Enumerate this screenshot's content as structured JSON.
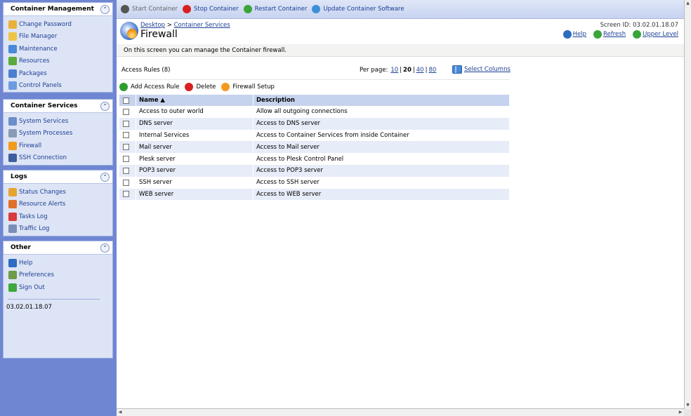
{
  "sidebar": {
    "panels": [
      {
        "title": "Container Management",
        "items": [
          {
            "label": "Change Password",
            "icon": "key-icon",
            "color": "#e8b23a"
          },
          {
            "label": "File Manager",
            "icon": "folder-icon",
            "color": "#f0c44a"
          },
          {
            "label": "Maintenance",
            "icon": "maintenance-icon",
            "color": "#4a88d8"
          },
          {
            "label": "Resources",
            "icon": "resources-chart-icon",
            "color": "#5bab3c"
          },
          {
            "label": "Packages",
            "icon": "packages-icon",
            "color": "#4c7fcf"
          },
          {
            "label": "Control Panels",
            "icon": "control-panels-icon",
            "color": "#6d9be0"
          }
        ]
      },
      {
        "title": "Container Services",
        "items": [
          {
            "label": "System Services",
            "icon": "system-services-icon",
            "color": "#6c8fc9"
          },
          {
            "label": "System Processes",
            "icon": "system-processes-icon",
            "color": "#8a9bb5"
          },
          {
            "label": "Firewall",
            "icon": "firewall-icon",
            "color": "#f39a1d"
          },
          {
            "label": "SSH Connection",
            "icon": "ssh-terminal-icon",
            "color": "#3d5f9e"
          }
        ]
      },
      {
        "title": "Logs",
        "items": [
          {
            "label": "Status Changes",
            "icon": "status-changes-icon",
            "color": "#e5a52e"
          },
          {
            "label": "Resource Alerts",
            "icon": "resource-alerts-icon",
            "color": "#e0712a"
          },
          {
            "label": "Tasks Log",
            "icon": "tasks-log-icon",
            "color": "#d83b3b"
          },
          {
            "label": "Traffic Log",
            "icon": "traffic-log-icon",
            "color": "#7a8fb8"
          }
        ]
      },
      {
        "title": "Other",
        "items": [
          {
            "label": "Help",
            "icon": "help-icon",
            "color": "#2d6cc0"
          },
          {
            "label": "Preferences",
            "icon": "preferences-icon",
            "color": "#6f9b4a"
          },
          {
            "label": "Sign Out",
            "icon": "sign-out-icon",
            "color": "#3fa83f"
          }
        ],
        "version": "03.02.01.18.07"
      }
    ]
  },
  "toolbar": {
    "buttons": [
      {
        "label": "Start Container",
        "icon": "start-icon",
        "color": "#555555",
        "disabled": true
      },
      {
        "label": "Stop Container",
        "icon": "stop-icon",
        "color": "#d92020",
        "disabled": false
      },
      {
        "label": "Restart Container",
        "icon": "restart-icon",
        "color": "#3aa53a",
        "disabled": false
      },
      {
        "label": "Update Container Software",
        "icon": "update-software-icon",
        "color": "#3c8fd6",
        "disabled": false
      }
    ]
  },
  "header": {
    "breadcrumb": [
      "Desktop",
      "Container Services"
    ],
    "breadcrumb_sep": ">",
    "title": "Firewall",
    "screen_id": "Screen ID: 03.02.01.18.07",
    "links": [
      {
        "label": "Help",
        "icon": "help-icon"
      },
      {
        "label": "Refresh",
        "icon": "refresh-icon"
      },
      {
        "label": "Upper Level",
        "icon": "upper-level-icon"
      }
    ]
  },
  "description": "On this screen you can manage the Container firewall.",
  "list": {
    "title": "Access Rules (8)",
    "per_page_label": "Per page:",
    "per_page_options": [
      "10",
      "20",
      "40",
      "80"
    ],
    "per_page_selected": "20",
    "select_columns": "Select Columns",
    "tools": [
      {
        "label": "Add Access Rule",
        "icon": "add-icon",
        "color": "#2e9c2e"
      },
      {
        "label": "Delete",
        "icon": "delete-icon",
        "color": "#d92020"
      },
      {
        "label": "Firewall Setup",
        "icon": "firewall-setup-icon",
        "color": "#f39a1d"
      }
    ],
    "columns": [
      "Name ▲",
      "Description"
    ],
    "rows": [
      {
        "name": "Access to outer world",
        "description": "Allow all outgoing connections"
      },
      {
        "name": "DNS server",
        "description": "Access to DNS server"
      },
      {
        "name": "Internal Services",
        "description": "Access to Container Services from inside Container"
      },
      {
        "name": "Mail server",
        "description": "Access to Mail server"
      },
      {
        "name": "Plesk server",
        "description": "Access to Plesk Control Panel"
      },
      {
        "name": "POP3 server",
        "description": "Access to POP3 server"
      },
      {
        "name": "SSH server",
        "description": "Access to SSH server"
      },
      {
        "name": "WEB server",
        "description": "Access to WEB server"
      }
    ]
  }
}
